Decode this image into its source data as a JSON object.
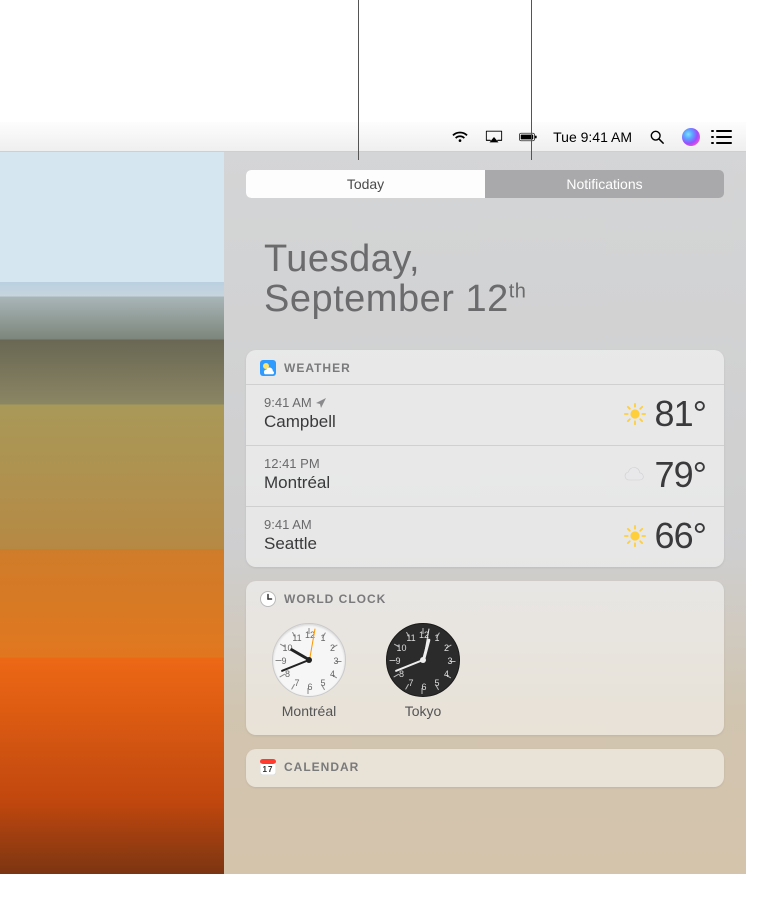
{
  "menubar": {
    "clock": "Tue 9:41 AM"
  },
  "tabs": {
    "today": "Today",
    "notifications": "Notifications"
  },
  "date": {
    "weekday": "Tuesday,",
    "month_day": "September 12",
    "ordinal": "th"
  },
  "weather": {
    "title": "WEATHER",
    "rows": [
      {
        "time": "9:41 AM",
        "city": "Campbell",
        "is_current_location": true,
        "condition": "sunny",
        "temp": "81°"
      },
      {
        "time": "12:41 PM",
        "city": "Montréal",
        "is_current_location": false,
        "condition": "cloudy",
        "temp": "79°"
      },
      {
        "time": "9:41 AM",
        "city": "Seattle",
        "is_current_location": false,
        "condition": "sunny",
        "temp": "66°"
      }
    ]
  },
  "world_clock": {
    "title": "WORLD CLOCK",
    "clocks": [
      {
        "city": "Montréal",
        "face": "light",
        "hour_angle": -60,
        "minute_angle": 248,
        "second_angle": 10
      },
      {
        "city": "Tokyo",
        "face": "dark",
        "hour_angle": 15,
        "minute_angle": 248,
        "second_angle": 10
      }
    ]
  },
  "calendar": {
    "title": "CALENDAR"
  }
}
